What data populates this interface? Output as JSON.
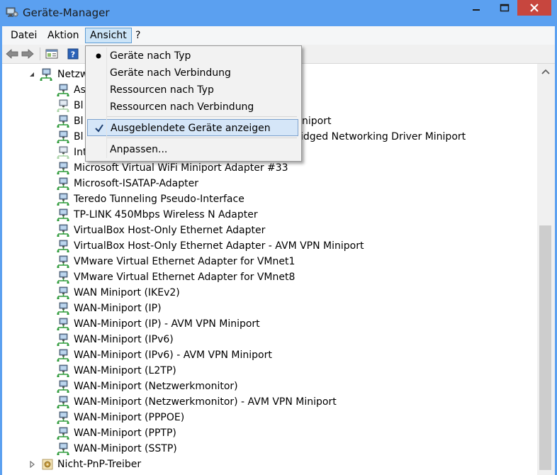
{
  "window": {
    "title": "Geräte-Manager",
    "app_icon": "device-manager-icon",
    "controls": [
      "minimize-icon",
      "maximize-icon",
      "close-icon"
    ]
  },
  "menubar": {
    "items": [
      {
        "label": "Datei"
      },
      {
        "label": "Aktion"
      },
      {
        "label": "Ansicht",
        "open": true
      },
      {
        "label": "?"
      }
    ]
  },
  "toolbar": {
    "buttons": [
      "back-arrow-icon",
      "forward-arrow-icon",
      "properties-icon",
      "help-icon"
    ]
  },
  "dropdown": {
    "items": [
      {
        "label": "Geräte nach Typ",
        "mark": "bullet"
      },
      {
        "label": "Geräte nach Verbindung",
        "mark": ""
      },
      {
        "label": "Ressourcen nach Typ",
        "mark": ""
      },
      {
        "label": "Ressourcen nach Verbindung",
        "mark": ""
      },
      {
        "label": "Ausgeblendete Geräte anzeigen",
        "mark": "check",
        "highlighted": true
      },
      {
        "label": "Anpassen...",
        "mark": ""
      }
    ]
  },
  "tree": {
    "category": {
      "label": "Netzw",
      "expanded": true
    },
    "partially_hidden_rows": [
      {
        "visible_text": "As"
      },
      {
        "visible_text": "Bl",
        "disabled": true
      },
      {
        "visible_text": "Bl",
        "suffix": "niport"
      },
      {
        "visible_text": "Bl",
        "suffix": "idged Networking Driver Miniport"
      },
      {
        "visible_text": "Int",
        "disabled": true
      }
    ],
    "items": [
      "Microsoft Virtual WiFi Miniport Adapter #33",
      "Microsoft-ISATAP-Adapter",
      "Teredo Tunneling Pseudo-Interface",
      "TP-LINK 450Mbps Wireless N Adapter",
      "VirtualBox Host-Only Ethernet Adapter",
      "VirtualBox Host-Only Ethernet Adapter - AVM VPN Miniport",
      "VMware Virtual Ethernet Adapter for VMnet1",
      "VMware Virtual Ethernet Adapter for VMnet8",
      "WAN Miniport (IKEv2)",
      "WAN-Miniport (IP)",
      "WAN-Miniport (IP) - AVM VPN Miniport",
      "WAN-Miniport (IPv6)",
      "WAN-Miniport (IPv6) - AVM VPN Miniport",
      "WAN-Miniport (L2TP)",
      "WAN-Miniport (Netzwerkmonitor)",
      "WAN-Miniport (Netzwerkmonitor) - AVM VPN Miniport",
      "WAN-Miniport (PPPOE)",
      "WAN-Miniport (PPTP)",
      "WAN-Miniport (SSTP)"
    ],
    "next_category": {
      "label": "Nicht-PnP-Treiber",
      "expanded": false
    }
  },
  "colors": {
    "titlebar": "#5ba0f0",
    "close_button": "#c7463e",
    "menu_open_bg": "#cce4f7",
    "highlight": "#d5e6f8"
  }
}
